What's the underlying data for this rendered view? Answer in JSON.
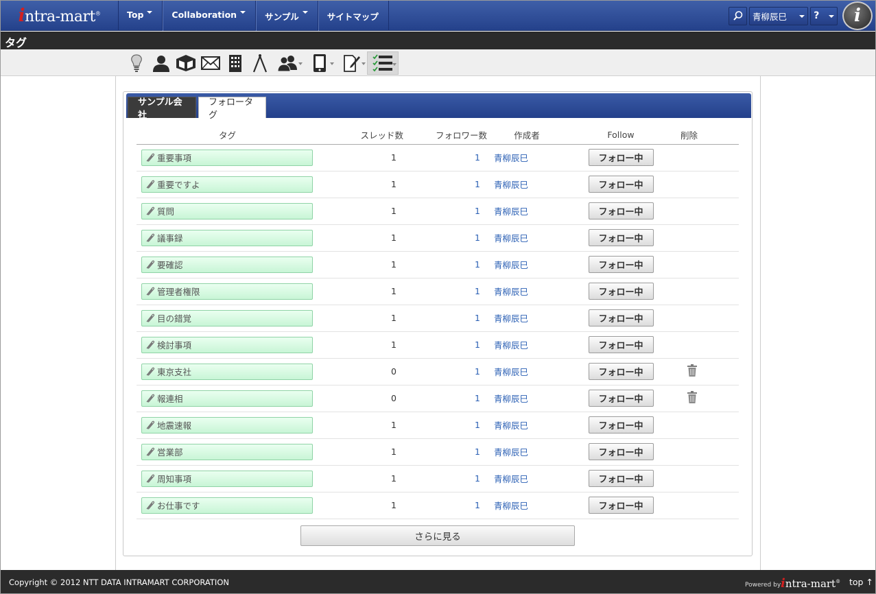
{
  "header": {
    "logo_text": "ntra-mart",
    "logo_i": "i",
    "logo_reg": "®",
    "nav": [
      {
        "label": "Top",
        "dropdown": true
      },
      {
        "label": "Collaboration",
        "dropdown": true
      },
      {
        "label": "サンプル",
        "dropdown": true
      },
      {
        "label": "サイトマップ",
        "dropdown": false
      }
    ],
    "user_name": "青柳辰巳",
    "help_label": "?",
    "im_icon": "i"
  },
  "page_title": "タグ",
  "toolbar": {
    "icons": [
      "lightbulb-icon",
      "user-icon",
      "box-icon",
      "mail-icon",
      "building-icon",
      "compass-icon",
      "group-icon",
      "tablet-icon",
      "edit-icon",
      "list-check-icon"
    ],
    "active": "list-check-icon"
  },
  "tabs": {
    "company": "サンプル会社",
    "followed": "フォロータグ"
  },
  "table": {
    "headers": {
      "tag": "タグ",
      "threads": "スレッド数",
      "followers": "フォロワー数",
      "author": "作成者",
      "follow": "Follow",
      "delete": "削除"
    },
    "rows": [
      {
        "tag": "重要事項",
        "threads": "1",
        "followers": "1",
        "author": "青柳辰巳",
        "follow": "フォロー中",
        "deletable": false
      },
      {
        "tag": "重要ですよ",
        "threads": "1",
        "followers": "1",
        "author": "青柳辰巳",
        "follow": "フォロー中",
        "deletable": false
      },
      {
        "tag": "質問",
        "threads": "1",
        "followers": "1",
        "author": "青柳辰巳",
        "follow": "フォロー中",
        "deletable": false
      },
      {
        "tag": "議事録",
        "threads": "1",
        "followers": "1",
        "author": "青柳辰巳",
        "follow": "フォロー中",
        "deletable": false
      },
      {
        "tag": "要確認",
        "threads": "1",
        "followers": "1",
        "author": "青柳辰巳",
        "follow": "フォロー中",
        "deletable": false
      },
      {
        "tag": "管理者権限",
        "threads": "1",
        "followers": "1",
        "author": "青柳辰巳",
        "follow": "フォロー中",
        "deletable": false
      },
      {
        "tag": "目の錯覚",
        "threads": "1",
        "followers": "1",
        "author": "青柳辰巳",
        "follow": "フォロー中",
        "deletable": false
      },
      {
        "tag": "検討事項",
        "threads": "1",
        "followers": "1",
        "author": "青柳辰巳",
        "follow": "フォロー中",
        "deletable": false
      },
      {
        "tag": "東京支社",
        "threads": "0",
        "followers": "1",
        "author": "青柳辰巳",
        "follow": "フォロー中",
        "deletable": true
      },
      {
        "tag": "報連相",
        "threads": "0",
        "followers": "1",
        "author": "青柳辰巳",
        "follow": "フォロー中",
        "deletable": true
      },
      {
        "tag": "地震速報",
        "threads": "1",
        "followers": "1",
        "author": "青柳辰巳",
        "follow": "フォロー中",
        "deletable": false
      },
      {
        "tag": "営業部",
        "threads": "1",
        "followers": "1",
        "author": "青柳辰巳",
        "follow": "フォロー中",
        "deletable": false
      },
      {
        "tag": "周知事項",
        "threads": "1",
        "followers": "1",
        "author": "青柳辰巳",
        "follow": "フォロー中",
        "deletable": false
      },
      {
        "tag": "お仕事です",
        "threads": "1",
        "followers": "1",
        "author": "青柳辰巳",
        "follow": "フォロー中",
        "deletable": false
      }
    ]
  },
  "more_label": "さらに見る",
  "footer": {
    "copyright": "Copyright © 2012 NTT DATA INTRAMART CORPORATION",
    "powered": "Powered by",
    "logo_text": "ntra-mart",
    "logo_i": "i",
    "logo_reg": "®",
    "top_label": "top ↑"
  },
  "colors": {
    "nav_bg": "#2e4f9c",
    "title_bg": "#2b2b2b",
    "link": "#2a5fb4",
    "tag_bg": "#d8f8e2",
    "tag_border": "#8fd3a6"
  }
}
